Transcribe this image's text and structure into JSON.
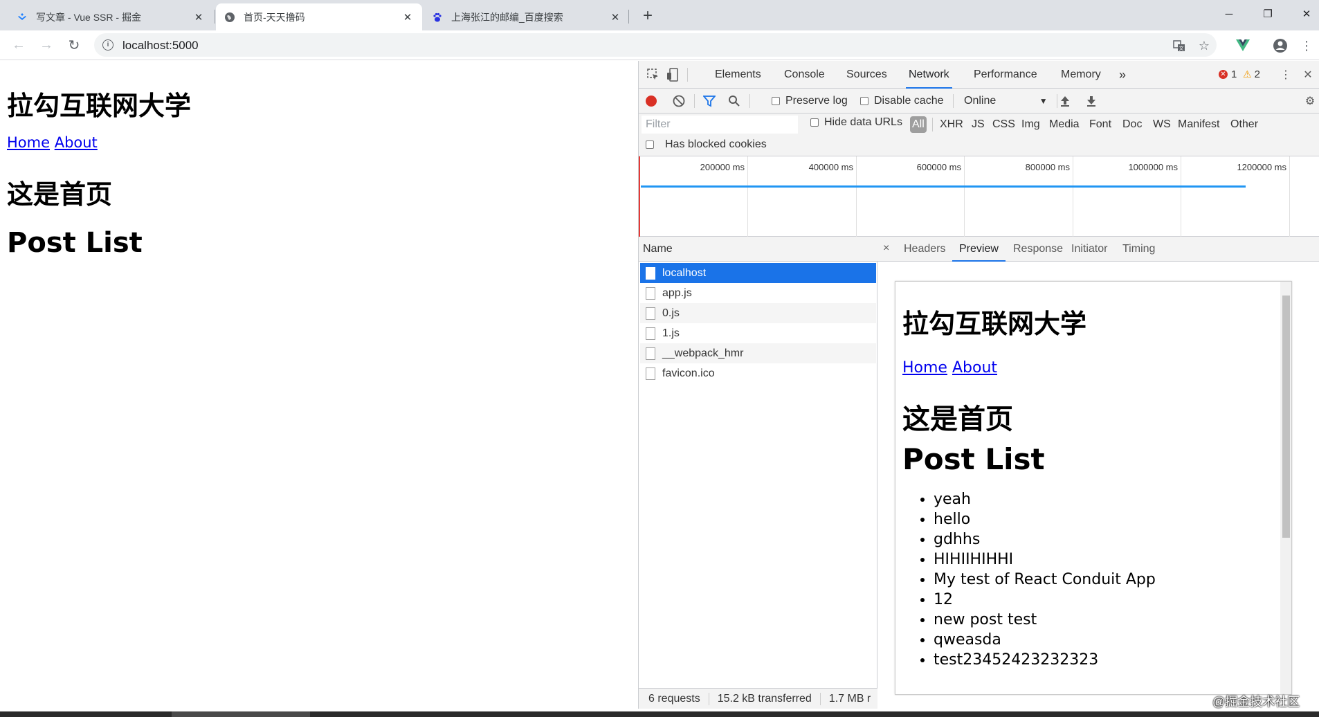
{
  "browser": {
    "tabs": [
      {
        "title": "写文章 - Vue SSR - 掘金",
        "icon": "juejin-icon"
      },
      {
        "title": "首页-天天撸码",
        "icon": "globe-icon"
      },
      {
        "title": "上海张江的邮编_百度搜索",
        "icon": "baidu-icon"
      }
    ],
    "active_tab": 1,
    "url": "localhost:5000"
  },
  "page": {
    "title": "拉勾互联网大学",
    "nav": {
      "home": "Home",
      "about": "About"
    },
    "home_heading": "这是首页",
    "posts_heading": "Post List"
  },
  "devtools": {
    "tabs": [
      "Elements",
      "Console",
      "Sources",
      "Network",
      "Performance",
      "Memory"
    ],
    "active_tab": "Network",
    "more": "»",
    "errors": "1",
    "warnings": "2",
    "toolbar": {
      "preserve_log": "Preserve log",
      "disable_cache": "Disable cache",
      "throttle": "Online"
    },
    "filter": {
      "placeholder": "Filter",
      "hide_data_urls": "Hide data URLs",
      "types": [
        "All",
        "XHR",
        "JS",
        "CSS",
        "Img",
        "Media",
        "Font",
        "Doc",
        "WS",
        "Manifest",
        "Other"
      ],
      "active_type": "All",
      "blocked_cookies": "Has blocked cookies"
    },
    "overview_ticks": [
      "200000 ms",
      "400000 ms",
      "600000 ms",
      "800000 ms",
      "1000000 ms",
      "1200000 ms"
    ],
    "requests": {
      "header": "Name",
      "items": [
        "localhost",
        "app.js",
        "0.js",
        "1.js",
        "__webpack_hmr",
        "favicon.ico"
      ],
      "selected": "localhost",
      "summary": [
        "6 requests",
        "15.2 kB transferred",
        "1.7 MB r"
      ]
    },
    "detail": {
      "tabs": [
        "Headers",
        "Preview",
        "Response",
        "Initiator",
        "Timing"
      ],
      "active_tab": "Preview",
      "close": "×"
    },
    "preview": {
      "title": "拉勾互联网大学",
      "nav": {
        "home": "Home",
        "about": "About"
      },
      "home_heading": "这是首页",
      "posts_heading": "Post List",
      "posts": [
        "yeah",
        "hello",
        "gdhhs",
        "HIHIIHIHHI",
        "My test of React Conduit App",
        "12",
        "new post test",
        "qweasda",
        "test23452423232323"
      ]
    }
  },
  "watermark": "@掘金技术社区",
  "colors": {
    "accent": "#1a73e8",
    "record": "#d93025",
    "link": "#0000ee"
  }
}
